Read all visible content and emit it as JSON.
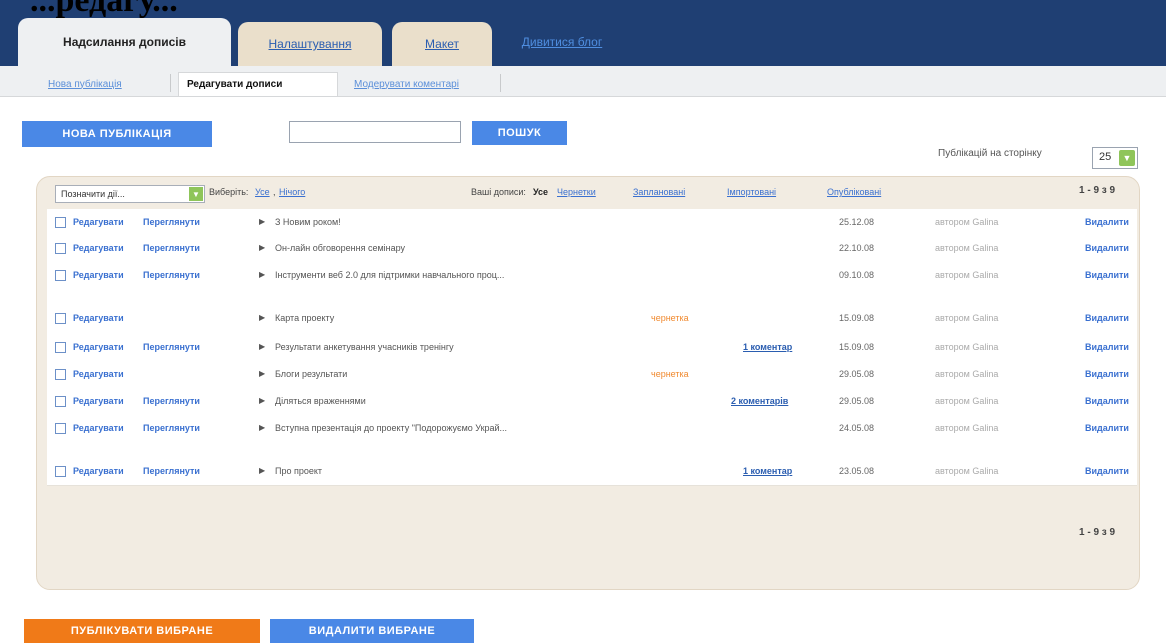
{
  "heading_fragment": "...редагу...",
  "main_tabs": [
    {
      "label": "Надсилання дописів",
      "active": true
    },
    {
      "label": "Налаштування",
      "active": false
    },
    {
      "label": "Макет",
      "active": false
    },
    {
      "label": "Дивитися блог",
      "active": false
    }
  ],
  "sub_tabs": [
    {
      "label": "Нова публікація",
      "active": false
    },
    {
      "label": "Редагувати дописи",
      "active": true
    },
    {
      "label": "Модерувати коментарі",
      "active": false
    }
  ],
  "toolbar": {
    "new_post_label": "НОВА ПУБЛІКАЦІЯ",
    "search_value": "",
    "search_button_label": "ПОШУК",
    "posts_per_page_label": "Публікацій на сторінку",
    "posts_per_page_value": "25"
  },
  "filters": {
    "show_select_value": "Позначити дії...",
    "select_label": "Виберіть:",
    "select_all": "Усе",
    "select_none": "Нічого",
    "your_posts_label": "Ваші дописи:",
    "filter_all": "Усе",
    "filter_drafts": "Чернетки",
    "filter_scheduled": "Заплановані",
    "filter_imported": "Імпортовані",
    "filter_published": "Опубліковані",
    "range_top": "1 - 9 з 9",
    "range_bottom": "1 - 9 з 9"
  },
  "posts": [
    {
      "edit": "Редагувати",
      "view": "Переглянути",
      "title": "З Новим роком!",
      "draft": "",
      "comments": "",
      "date": "25.12.08",
      "author": "автором Galina",
      "delete": "Видалити"
    },
    {
      "edit": "Редагувати",
      "view": "Переглянути",
      "title": "Он-лайн обговорення семінару",
      "draft": "",
      "comments": "",
      "date": "22.10.08",
      "author": "автором Galina",
      "delete": "Видалити"
    },
    {
      "edit": "Редагувати",
      "view": "Переглянути",
      "title": "Інструменти веб 2.0 для підтримки навчального проц...",
      "draft": "",
      "comments": "",
      "date": "09.10.08",
      "author": "автором Galina",
      "delete": "Видалити"
    },
    {
      "edit": "Редагувати",
      "view": "",
      "title": "Карта проекту",
      "draft": "чернетка",
      "comments": "",
      "date": "15.09.08",
      "author": "автором Galina",
      "delete": "Видалити"
    },
    {
      "edit": "Редагувати",
      "view": "Переглянути",
      "title": "Результати анкетування учасників тренінгу",
      "draft": "",
      "comments": "1 коментар",
      "date": "15.09.08",
      "author": "автором Galina",
      "delete": "Видалити"
    },
    {
      "edit": "Редагувати",
      "view": "",
      "title": "Блоги результати",
      "draft": "чернетка",
      "comments": "",
      "date": "29.05.08",
      "author": "автором Galina",
      "delete": "Видалити"
    },
    {
      "edit": "Редагувати",
      "view": "Переглянути",
      "title": "Діляться враженнями",
      "draft": "",
      "comments": "2 коментарів",
      "date": "29.05.08",
      "author": "автором Galina",
      "delete": "Видалити"
    },
    {
      "edit": "Редагувати",
      "view": "Переглянути",
      "title": "Вступна презентація до проекту \"Подорожуємо Украй...",
      "draft": "",
      "comments": "",
      "date": "24.05.08",
      "author": "автором Galina",
      "delete": "Видалити"
    },
    {
      "edit": "Редагувати",
      "view": "Переглянути",
      "title": "Про проект",
      "draft": "",
      "comments": "1 коментар",
      "date": "23.05.08",
      "author": "автором Galina",
      "delete": "Видалити"
    }
  ],
  "bottom": {
    "publish_selected": "ПУБЛІКУВАТИ ВИБРАНЕ",
    "delete_selected": "ВИДАЛИТИ ВИБРАНЕ"
  }
}
